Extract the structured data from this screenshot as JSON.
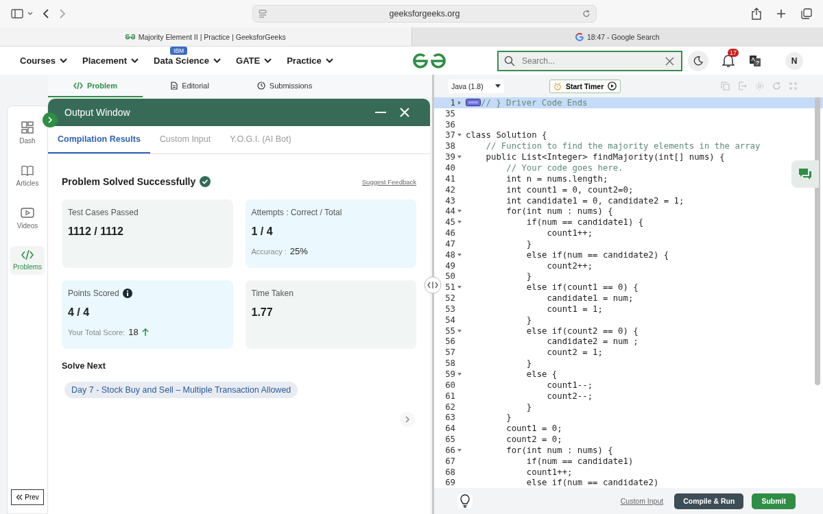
{
  "browser": {
    "address": "geeksforgeeks.org",
    "tabs": [
      {
        "title": "Majority Element II | Practice | GeeksforGeeks",
        "kind": "gfg",
        "selected": true
      },
      {
        "title": "18:47 - Google Search",
        "kind": "google",
        "selected": false
      }
    ]
  },
  "site_nav": {
    "menu": [
      {
        "label": "Courses"
      },
      {
        "label": "Placement"
      },
      {
        "label": "Data Science",
        "badge": "IBM"
      },
      {
        "label": "GATE"
      },
      {
        "label": "Practice"
      }
    ],
    "search": {
      "placeholder": "Search..."
    },
    "notifications": "17",
    "avatar": "N"
  },
  "problem_tabs": [
    {
      "label": "Problem",
      "kind": "code",
      "selected": true
    },
    {
      "label": "Editorial",
      "kind": "doc",
      "selected": false
    },
    {
      "label": "Submissions",
      "kind": "clock",
      "selected": false
    }
  ],
  "sidebar": [
    {
      "label": "Dash",
      "kind": "dash",
      "selected": false
    },
    {
      "label": "Articles",
      "kind": "book",
      "selected": false
    },
    {
      "label": "Videos",
      "kind": "video",
      "selected": false
    },
    {
      "label": "Problems",
      "kind": "code",
      "selected": true
    }
  ],
  "prev_button": "Prev",
  "output_window": {
    "title": "Output Window",
    "tabs": [
      {
        "label": "Compilation Results",
        "selected": true
      },
      {
        "label": "Custom Input",
        "selected": false
      },
      {
        "label": "Y.O.G.I. (AI Bot)",
        "selected": false
      }
    ],
    "status": "Problem Solved Successfully",
    "feedback_link": "Suggest Feedback",
    "cards": [
      {
        "label": "Test Cases Passed",
        "value": "1112 / 1112",
        "color": "#f1f6f5"
      },
      {
        "label": "Attempts : Correct / Total",
        "value": "1 / 4",
        "color": "#ebf8fd",
        "detail": {
          "label": "Accuracy :",
          "value": "25%"
        }
      },
      {
        "label": "Points Scored",
        "value": "4 / 4",
        "color": "#ebf8fd",
        "info_icon": true,
        "detail": {
          "label": "Your Total Score:",
          "value": "18",
          "rising": true
        }
      },
      {
        "label": "Time Taken",
        "value": "1.77",
        "color": "#f1f6f5"
      }
    ],
    "solve_next": {
      "heading": "Solve Next",
      "items": [
        "Day 7 - Stock Buy and Sell – Multiple Transaction Allowed"
      ]
    }
  },
  "editor": {
    "language": "Java (1.8)",
    "timer_button": "Start Timer",
    "lines": [
      {
        "number": "1",
        "text": "// } Driver Code Ends",
        "kind": "comment",
        "expanded": false,
        "active": true
      },
      {
        "number": "35",
        "active": false
      },
      {
        "number": "36",
        "active": false
      },
      {
        "number": "37",
        "text": "class Solution {",
        "kind": "code",
        "expanded": true,
        "active": false
      },
      {
        "number": "38",
        "text": "    // Function to find the majority elements in the array",
        "kind": "comment",
        "active": false
      },
      {
        "number": "39",
        "text": "    public List<Integer> findMajority(int[] nums) {",
        "kind": "code",
        "expanded": true,
        "active": false
      },
      {
        "number": "40",
        "text": "        // Your code goes here.",
        "kind": "comment",
        "active": false
      },
      {
        "number": "41",
        "text": "        int n = nums.length;",
        "kind": "code",
        "active": false
      },
      {
        "number": "42",
        "text": "        int count1 = 0, count2=0;",
        "kind": "code",
        "active": false
      },
      {
        "number": "43",
        "text": "        int candidate1 = 0, candidate2 = 1;",
        "kind": "code",
        "active": false
      },
      {
        "number": "44",
        "text": "        for(int num : nums) {",
        "kind": "code",
        "expanded": true,
        "active": false
      },
      {
        "number": "45",
        "text": "            if(num == candidate1) {",
        "kind": "code",
        "expanded": true,
        "active": false
      },
      {
        "number": "46",
        "text": "                count1++;",
        "kind": "code",
        "active": false
      },
      {
        "number": "47",
        "text": "            }",
        "kind": "code",
        "active": false
      },
      {
        "number": "48",
        "text": "            else if(num == candidate2) {",
        "kind": "code",
        "expanded": true,
        "active": false
      },
      {
        "number": "49",
        "text": "                count2++;",
        "kind": "code",
        "active": false
      },
      {
        "number": "50",
        "text": "            }",
        "kind": "code",
        "active": false
      },
      {
        "number": "51",
        "text": "            else if(count1 == 0) {",
        "kind": "code",
        "expanded": true,
        "active": false
      },
      {
        "number": "52",
        "text": "                candidate1 = num;",
        "kind": "code",
        "active": false
      },
      {
        "number": "53",
        "text": "                count1 = 1;",
        "kind": "code",
        "active": false
      },
      {
        "number": "54",
        "text": "            }",
        "kind": "code",
        "active": false
      },
      {
        "number": "55",
        "text": "            else if(count2 == 0) {",
        "kind": "code",
        "expanded": true,
        "active": false
      },
      {
        "number": "56",
        "text": "                candidate2 = num ;",
        "kind": "code",
        "active": false
      },
      {
        "number": "57",
        "text": "                count2 = 1;",
        "kind": "code",
        "active": false
      },
      {
        "number": "58",
        "text": "            }",
        "kind": "code",
        "active": false
      },
      {
        "number": "59",
        "text": "            else {",
        "kind": "code",
        "expanded": true,
        "active": false
      },
      {
        "number": "60",
        "text": "                count1--;",
        "kind": "code",
        "active": false
      },
      {
        "number": "61",
        "text": "                count2--;",
        "kind": "code",
        "active": false
      },
      {
        "number": "62",
        "text": "            }",
        "kind": "code",
        "active": false
      },
      {
        "number": "63",
        "text": "        }",
        "kind": "code",
        "active": false
      },
      {
        "number": "64",
        "text": "        count1 = 0;",
        "kind": "code",
        "active": false
      },
      {
        "number": "65",
        "text": "        count2 = 0;",
        "kind": "code",
        "active": false
      },
      {
        "number": "66",
        "text": "        for(int num : nums) {",
        "kind": "code",
        "expanded": true,
        "active": false
      },
      {
        "number": "67",
        "text": "            if(num == candidate1)",
        "kind": "code",
        "active": false
      },
      {
        "number": "68",
        "text": "            count1++;",
        "kind": "code",
        "active": false
      },
      {
        "number": "69",
        "text": "            else if(num == candidate2)",
        "kind": "code",
        "active": false
      }
    ],
    "custom_input_link": "Custom Input",
    "compile_button": "Compile & Run",
    "submit_button": "Submit"
  }
}
